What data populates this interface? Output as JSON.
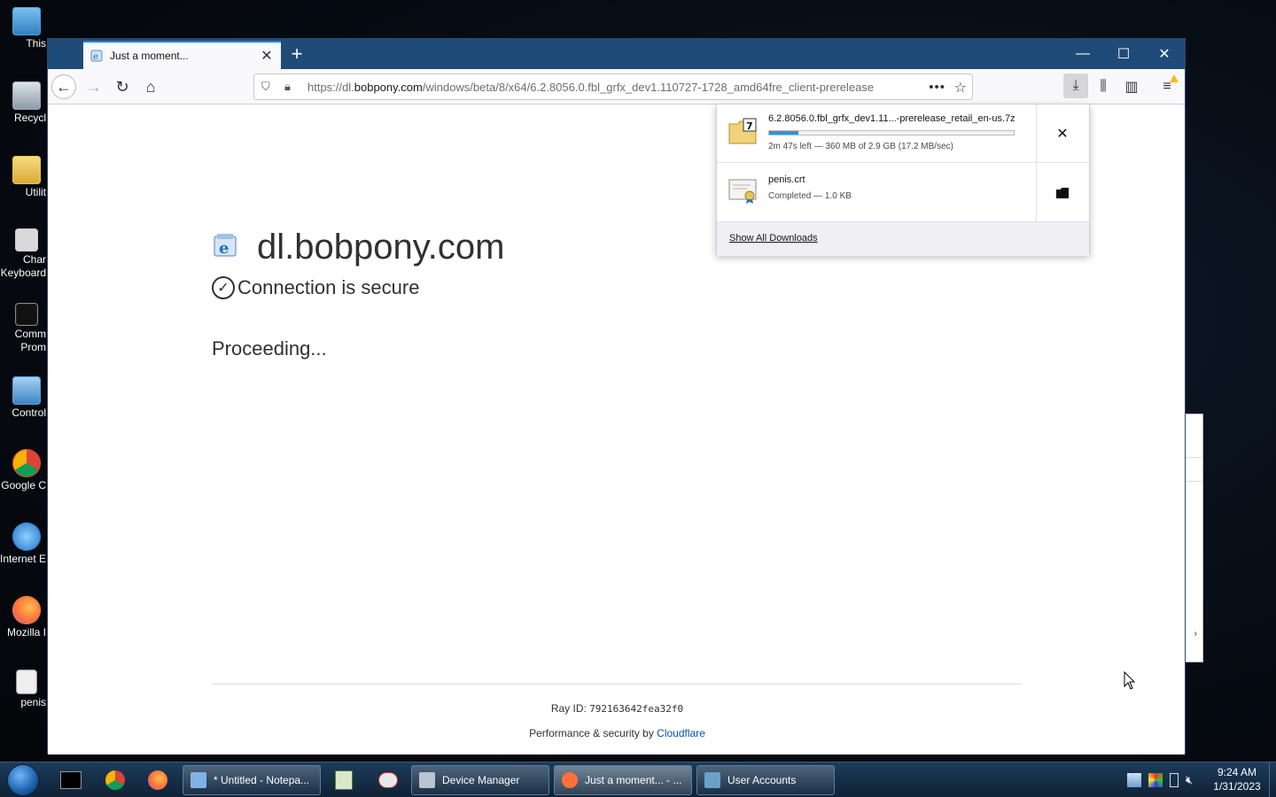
{
  "desktop": {
    "icons": [
      {
        "label": "This",
        "color": "#4aa3e0"
      },
      {
        "label": "Recycl",
        "color": "#9aa7b4"
      },
      {
        "label": "Utilit",
        "color": "#e8c35a"
      },
      {
        "label": "Char Keyboard",
        "color": "#c9c9c9"
      },
      {
        "label": "Comm Prom",
        "color": "#222222"
      },
      {
        "label": "Control",
        "color": "#5aa0d8"
      },
      {
        "label": "Google C",
        "color": "#db4437"
      },
      {
        "label": "Internet E",
        "color": "#2c7fd6"
      },
      {
        "label": "Mozilla I",
        "color": "#ff7139"
      },
      {
        "label": "penis",
        "color": "#e6e6e6"
      }
    ]
  },
  "browser": {
    "tab": {
      "title": "Just a moment...",
      "close": "✕"
    },
    "new_tab": "+",
    "window_controls": {
      "minimize": "—",
      "maximize": "☐",
      "close": "✕"
    },
    "nav": {
      "back": "←",
      "forward": "→",
      "reload": "↻",
      "home": "⌂"
    },
    "url": {
      "scheme": "https://dl.",
      "host": "bobpony.com",
      "path": "/windows/beta/8/x64/6.2.8056.0.fbl_grfx_dev1.110727-1728_amd64fre_client-prerelease",
      "more": "•••",
      "star": "☆"
    },
    "toolbar": {
      "download": "⤓",
      "library": "⫼",
      "sidebar": "▥",
      "menu": "≡"
    }
  },
  "page": {
    "site_title": "dl.bobpony.com",
    "secure_check": "✓",
    "secure_text": "Connection is secure",
    "status_text": "Proceeding...",
    "ray_label": "Ray ID: ",
    "ray_id": "792163642fea32f0",
    "perf_prefix": "Performance & security by ",
    "perf_link": "Cloudflare"
  },
  "downloads": {
    "items": [
      {
        "filename": "6.2.8056.0.fbl_grfx_dev1.11...-prerelease_retail_en-us.7z",
        "status": "2m 47s left — 360 MB of 2.9 GB (17.2 MB/sec)",
        "progress": 0.12,
        "action_icon": "✕",
        "action_name": "cancel-download-button"
      },
      {
        "filename": "penis.crt",
        "status": "Completed — 1.0 KB",
        "action_icon": "▰",
        "action_name": "open-folder-button"
      }
    ],
    "show_all": "Show All Downloads"
  },
  "taskbar": {
    "buttons": [
      {
        "label": "* Untitled - Notepa...",
        "color": "#7fb3e8"
      },
      {
        "label": "Device Manager",
        "color": "#b8c4cf"
      },
      {
        "label": "Just a moment... - ...",
        "color": "#ff7139"
      },
      {
        "label": "User Accounts",
        "color": "#6aa0c8"
      }
    ],
    "clock_time": "9:24 AM",
    "clock_date": "1/31/2023"
  }
}
